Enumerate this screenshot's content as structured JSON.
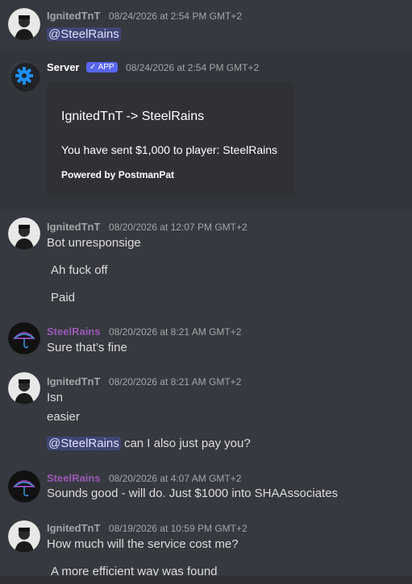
{
  "messages": [
    {
      "author": "IgnitedTnT",
      "time": "08/24/2026 at 2:54 PM GMT+2",
      "mention": "@SteelRains"
    },
    {
      "author": "Server",
      "badge": "APP",
      "time": "08/24/2026 at 2:54 PM GMT+2",
      "embed": {
        "title": "IgnitedTnT -> SteelRains",
        "description": "You have sent $1,000 to player: SteelRains",
        "footer": "Powered by PostmanPat"
      }
    },
    {
      "author": "IgnitedTnT",
      "time": "08/20/2026 at 12:07 PM GMT+2",
      "lines": [
        "Bot unresponsige",
        "Ah fuck off",
        "Paid"
      ]
    },
    {
      "author": "SteelRains",
      "time": "08/20/2026 at 8:21 AM GMT+2",
      "lines": [
        "Sure that’s fine"
      ]
    },
    {
      "author": "IgnitedTnT",
      "time": "08/20/2026 at 8:21 AM GMT+2",
      "lines": [
        "Isn",
        "easier"
      ],
      "mention": "@SteelRains",
      "mention_suffix": " can I also just pay you?"
    },
    {
      "author": "SteelRains",
      "time": "08/20/2026 at 4:07 AM GMT+2",
      "lines": [
        "Sounds good - will do. Just $1000 into SHAAssociates"
      ]
    },
    {
      "author": "IgnitedTnT",
      "time": "08/19/2026 at 10:59 PM GMT+2",
      "lines": [
        "How much will the service cost me?",
        "A more efficient way was found"
      ]
    }
  ],
  "colors": {
    "bg": "#36393f",
    "embed_bg": "#2f3136",
    "mention_bg": "#5865f2",
    "steelrains": "#9b59b6"
  },
  "icons": {
    "server_avatar": "gear-icon",
    "badge_check": "check-icon"
  }
}
